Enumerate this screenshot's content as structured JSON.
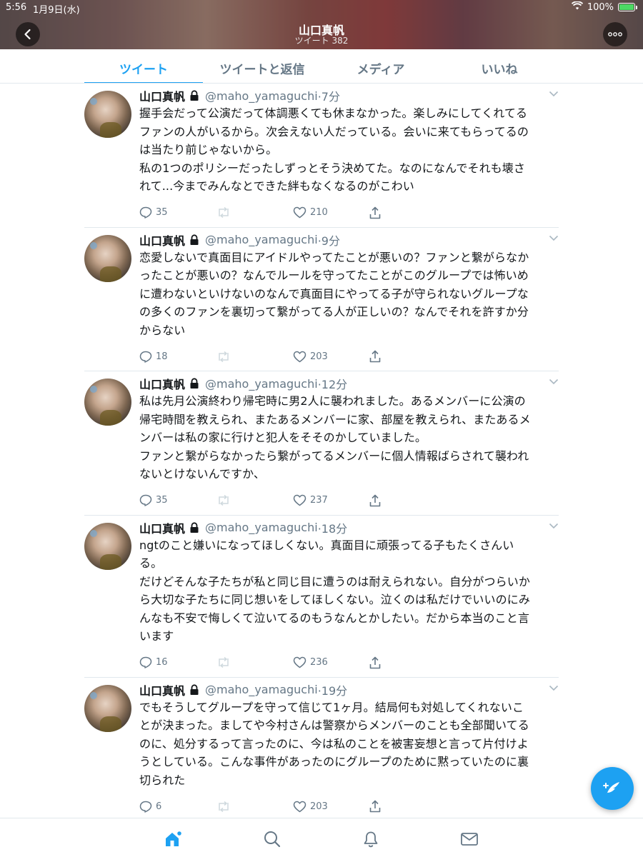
{
  "status_bar": {
    "time": "5:56",
    "date": "1月9日(水)",
    "battery": "100%"
  },
  "header": {
    "title": "山口真帆",
    "subtitle": "ツイート 382"
  },
  "tabs": [
    {
      "label": "ツイート",
      "active": true
    },
    {
      "label": "ツイートと返信",
      "active": false
    },
    {
      "label": "メディア",
      "active": false
    },
    {
      "label": "いいね",
      "active": false
    }
  ],
  "tweets": [
    {
      "name": "山口真帆",
      "handle": "@maho_yamaguchi",
      "time": "·7分",
      "text": "握手会だって公演だって体調悪くても休まなかった。楽しみにしてくれてる\nファンの人がいるから。次会えない人だっている。会いに来てもらってるの\nは当たり前じゃないから。\n私の1つのポリシーだったしずっとそう決めてた。なのになんでそれも壊さ\nれて...今までみんなとできた絆もなくなるのがこわい",
      "replies": "35",
      "likes": "210"
    },
    {
      "name": "山口真帆",
      "handle": "@maho_yamaguchi",
      "time": "·9分",
      "text": "恋愛しないで真面目にアイドルやってたことが悪いの？ファンと繋がらなか\nったことが悪いの？なんでルールを守ってたことがこのグループでは怖いめ\nに遭わないといけないのなんで真面目にやってる子が守られないグループな\nの多くのファンを裏切って繋がってる人が正しいの？なんでそれを許すか分\nからない",
      "replies": "18",
      "likes": "203"
    },
    {
      "name": "山口真帆",
      "handle": "@maho_yamaguchi",
      "time": "·12分",
      "text": "私は先月公演終わり帰宅時に男2人に襲われました。あるメンバーに公演の\n帰宅時間を教えられ、またあるメンバーに家、部屋を教えられ、またあるメ\nンバーは私の家に行けと犯人をそそのかしていました。\nファンと繋がらなかったら繋がってるメンバーに個人情報ばらされて襲われ\nないとけないんですか、",
      "replies": "35",
      "likes": "237"
    },
    {
      "name": "山口真帆",
      "handle": "@maho_yamaguchi",
      "time": "·18分",
      "text": "ngtのこと嫌いになってほしくない。真面目に頑張ってる子もたくさんい\nる。\nだけどそんな子たちが私と同じ目に遭うのは耐えられない。自分がつらいか\nら大切な子たちに同じ想いをしてほしくない。泣くのは私だけでいいのにみ\nんなも不安で悔しくて泣いてるのもうなんとかしたい。だから本当のこと言\nいます",
      "replies": "16",
      "likes": "236"
    },
    {
      "name": "山口真帆",
      "handle": "@maho_yamaguchi",
      "time": "·19分",
      "text": "でもそうしてグループを守って信じて1ヶ月。結局何も対処してくれないこ\nとが決まった。ましてや今村さんは警察からメンバーのことも全部聞いてる\nのに、処分するって言ったのに、今は私のことを被害妄想と言って片付けよ\nうとしている。こんな事件があったのにグループのために黙っていたのに裏\n切られた",
      "replies": "6",
      "likes": "203"
    }
  ],
  "icons": {
    "back": "chevron-left-icon",
    "more": "more-dots-icon",
    "reply": "reply-icon",
    "retweet": "retweet-icon",
    "like": "heart-icon",
    "share": "share-icon",
    "compose": "compose-feather-icon",
    "nav": [
      "home-icon",
      "search-icon",
      "bell-icon",
      "mail-icon"
    ]
  },
  "colors": {
    "accent": "#1da1f2",
    "secondary_text": "#657786"
  }
}
